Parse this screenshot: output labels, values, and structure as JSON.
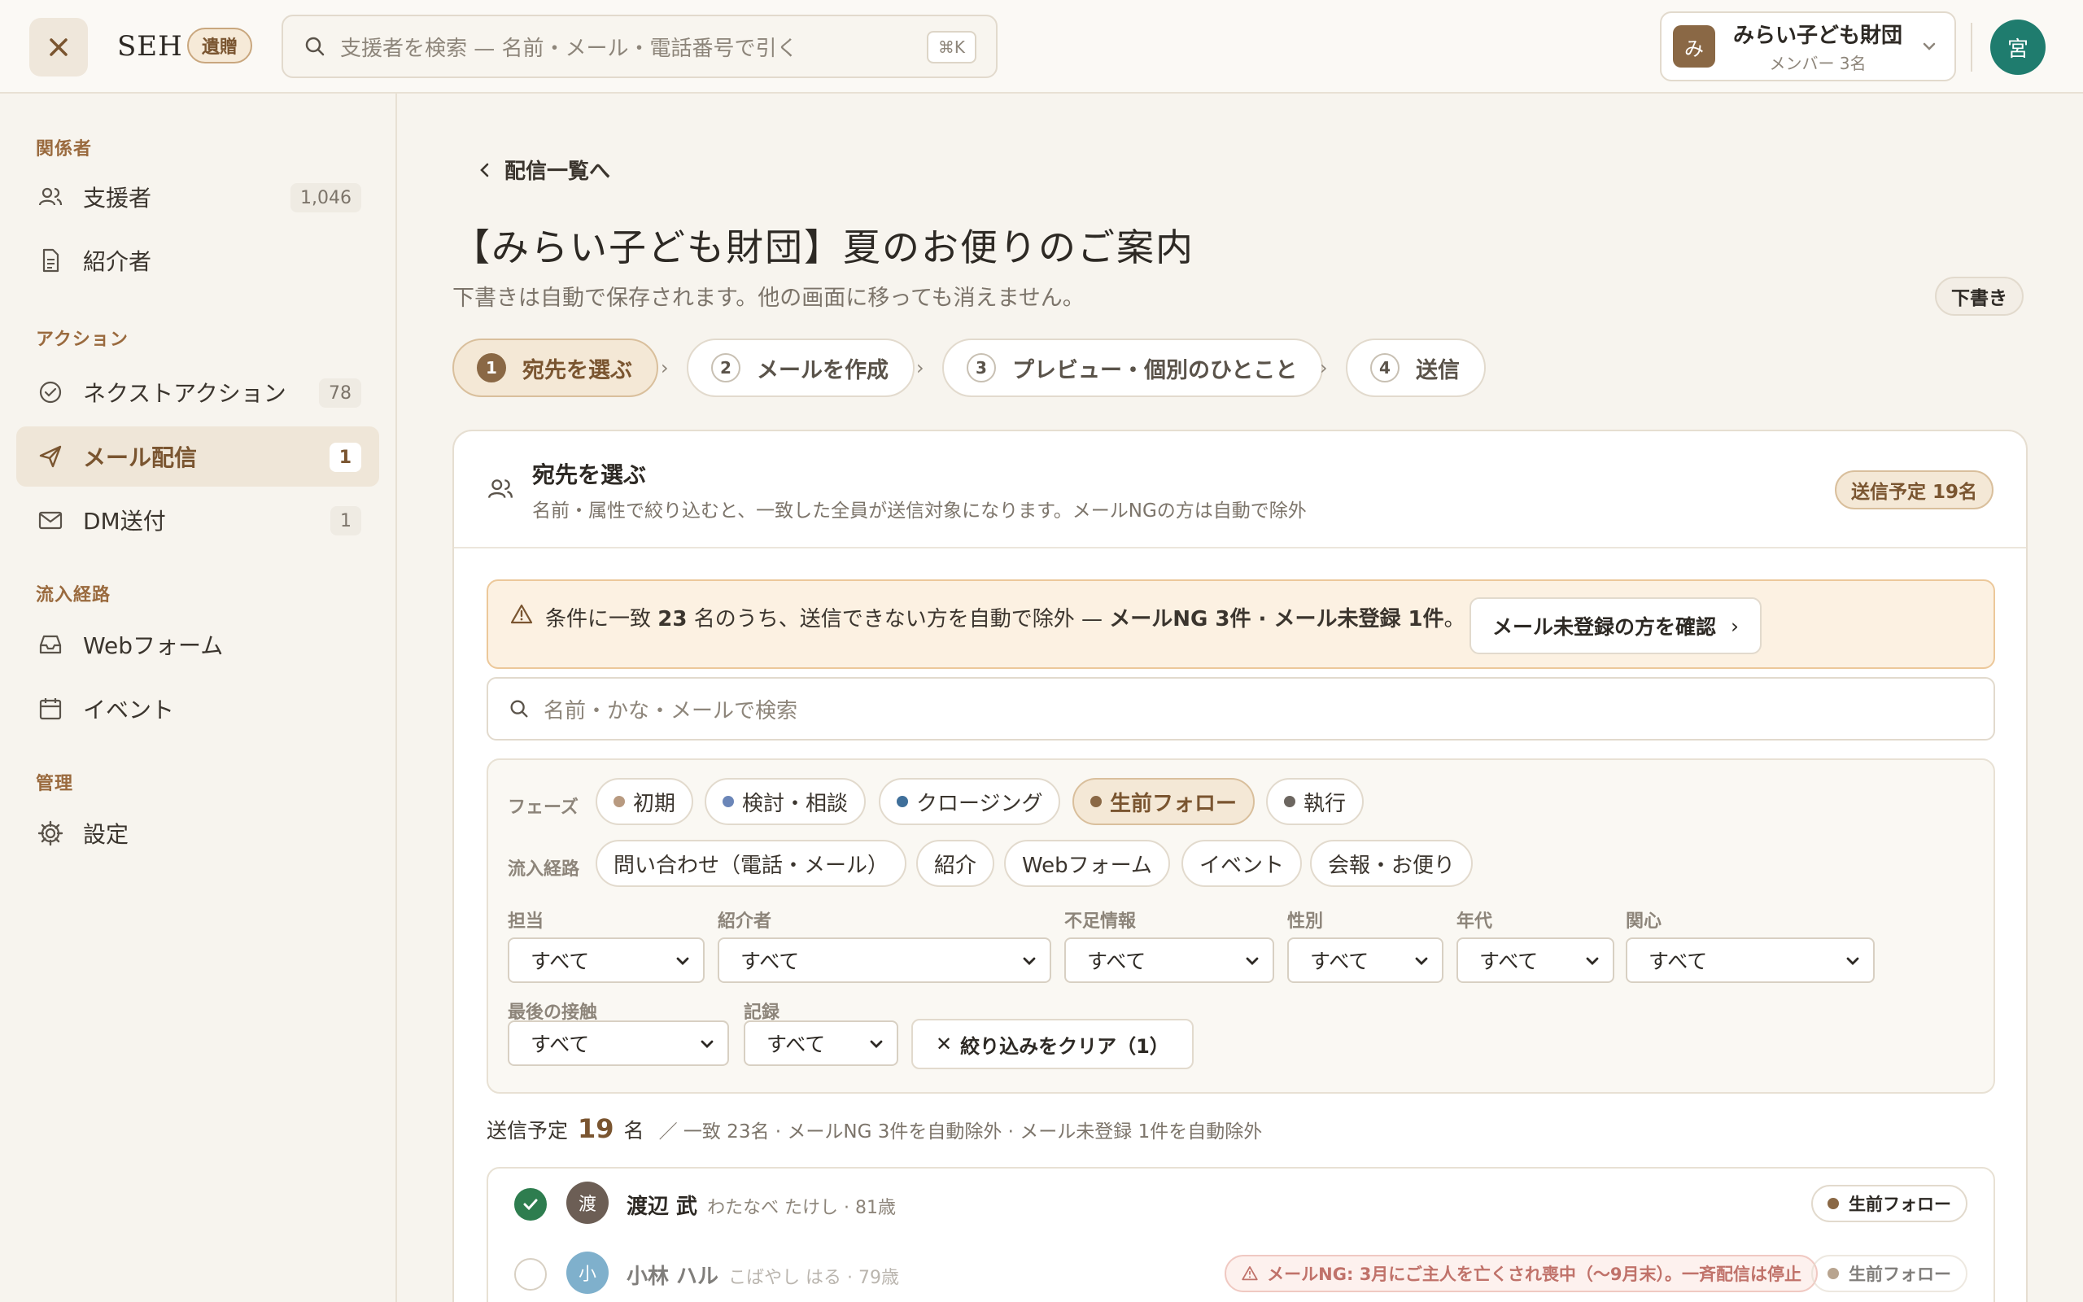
{
  "header": {
    "brand": "SEH",
    "brand_badge": "遺贈",
    "search_placeholder": "支援者を検索 — 名前・メール・電話番号で引く",
    "search_shortcut": "⌘K",
    "org_avatar": "み",
    "org_name": "みらい子ども財団",
    "org_members": "メンバー 3名",
    "user_avatar": "宮"
  },
  "sidebar": {
    "sections": [
      {
        "label": "関係者"
      },
      {
        "label": "アクション"
      },
      {
        "label": "流入経路"
      },
      {
        "label": "管理"
      }
    ],
    "items": [
      {
        "label": "支援者",
        "count": "1,046",
        "icon": "users-icon"
      },
      {
        "label": "紹介者",
        "icon": "document-icon"
      },
      {
        "label": "ネクストアクション",
        "count": "78",
        "icon": "check-circle-icon"
      },
      {
        "label": "メール配信",
        "count": "1",
        "icon": "send-icon",
        "active": true
      },
      {
        "label": "DM送付",
        "count": "1",
        "icon": "mail-icon"
      },
      {
        "label": "Webフォーム",
        "icon": "inbox-icon"
      },
      {
        "label": "イベント",
        "icon": "calendar-icon"
      },
      {
        "label": "設定",
        "icon": "gear-icon"
      }
    ]
  },
  "main": {
    "back_link": "配信一覧へ",
    "title": "【みらい子ども財団】夏のお便りのご案内",
    "subtitle": "下書きは自動で保存されます。他の画面に移っても消えません。",
    "status": "下書き",
    "steps": [
      {
        "num": "1",
        "label": "宛先を選ぶ"
      },
      {
        "num": "2",
        "label": "メールを作成"
      },
      {
        "num": "3",
        "label": "プレビュー・個別のひとこと"
      },
      {
        "num": "4",
        "label": "送信"
      }
    ]
  },
  "recipients": {
    "title": "宛先を選ぶ",
    "description": "名前・属性で絞り込むと、一致した全員が送信対象になります。メールNGの方は自動で除外",
    "send_badge": "送信予定 19名",
    "warning": {
      "pre": "条件に一致 ",
      "matched": "23",
      "mid": " 名のうち、送信できない方を自動で除外 — ",
      "excluded": "メールNG 3件 · メール未登録 1件",
      "post": "。",
      "button": "メール未登録の方を確認"
    },
    "search_placeholder": "名前・かな・メールで検索",
    "filters": {
      "phase_label": "フェーズ",
      "phases": [
        {
          "label": "初期",
          "color": "#b89a80"
        },
        {
          "label": "検討・相談",
          "color": "#6b86b8"
        },
        {
          "label": "クロージング",
          "color": "#3f6f9a"
        },
        {
          "label": "生前フォロー",
          "color": "#8a6845",
          "active": true
        },
        {
          "label": "執行",
          "color": "#6c6660"
        }
      ],
      "source_label": "流入経路",
      "sources": [
        "問い合わせ（電話・メール）",
        "紹介",
        "Webフォーム",
        "イベント",
        "会報・お便り"
      ],
      "selects": [
        {
          "label": "担当",
          "value": "すべて"
        },
        {
          "label": "紹介者",
          "value": "すべて"
        },
        {
          "label": "不足情報",
          "value": "すべて"
        },
        {
          "label": "性別",
          "value": "すべて"
        },
        {
          "label": "年代",
          "value": "すべて"
        },
        {
          "label": "関心",
          "value": "すべて"
        },
        {
          "label": "最後の接触",
          "value": "すべて"
        },
        {
          "label": "記録",
          "value": "すべて"
        }
      ],
      "clear_button": "絞り込みをクリア（1）"
    },
    "summary": {
      "prefix": "送信予定",
      "count": "19",
      "unit": "名",
      "detail": "／ 一致 23名 · メールNG 3件を自動除外 · メール未登録 1件を自動除外"
    },
    "people": [
      {
        "avatar": "渡",
        "avatar_color": "#6c5e55",
        "name": "渡辺 武",
        "meta": "わたなべ たけし · 81歳",
        "phase": "生前フォロー",
        "checked": true
      },
      {
        "avatar": "小",
        "avatar_color": "#7fb0cc",
        "name": "小林 ハル",
        "meta": "こばやし はる · 79歳",
        "phase": "生前フォロー",
        "checked": false,
        "ng": "メールNG: 3月にご主人を亡くされ喪中（〜9月末）。一斉配信は停止"
      }
    ]
  }
}
